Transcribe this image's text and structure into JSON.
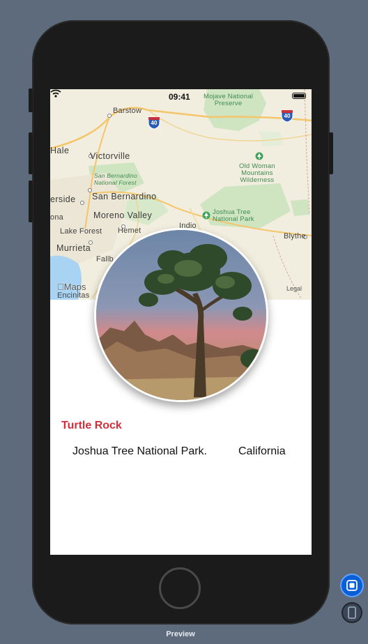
{
  "status_bar": {
    "time": "09:41"
  },
  "map": {
    "labels": {
      "barstow": "Barstow",
      "victorville": "Victorville",
      "hale": "Hale",
      "riverside": "erside",
      "san_bernardino": "San Bernardino",
      "moreno_valley": "Moreno Valley",
      "ona": "ona",
      "hemet": "Hemet",
      "lake_forest": "Lake Forest",
      "murrieta": "Murrieta",
      "fallb": "Fallb",
      "encinitas": "Encinitas",
      "indio": "Indio",
      "blythe": "Blythe",
      "mojave": "Mojave National\nPreserve",
      "old_woman": "Old Woman\nMountains\nWilderness",
      "joshua_tree": "Joshua Tree\nNational Park",
      "sb_forest": "San Bernardino\nNational Forest",
      "shield_40": "40"
    },
    "attribution": "Maps",
    "legal": "Legal"
  },
  "landmark": {
    "name": "Turtle Rock",
    "park": "Joshua Tree National Park.",
    "state": "California"
  },
  "canvas": {
    "preview_label": "Preview"
  },
  "colors": {
    "canvas_bg": "#5d6b7c",
    "title_red": "#d12f3b",
    "accent_blue": "#0a5fd6"
  }
}
